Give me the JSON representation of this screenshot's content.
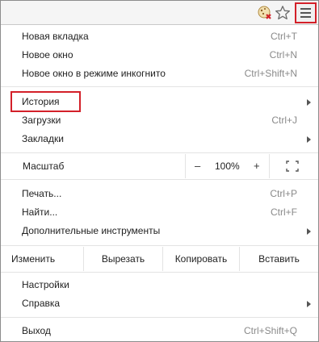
{
  "toolbar": {
    "extension_icon": "cookie-blocked-icon",
    "bookmark_icon": "star-icon",
    "menu_icon": "hamburger-menu-icon"
  },
  "menu": {
    "new_tab": {
      "label": "Новая вкладка",
      "shortcut": "Ctrl+T"
    },
    "new_window": {
      "label": "Новое окно",
      "shortcut": "Ctrl+N"
    },
    "new_incognito": {
      "label": "Новое окно в режиме инкогнито",
      "shortcut": "Ctrl+Shift+N"
    },
    "history": {
      "label": "История"
    },
    "downloads": {
      "label": "Загрузки",
      "shortcut": "Ctrl+J"
    },
    "bookmarks": {
      "label": "Закладки"
    },
    "zoom": {
      "label": "Масштаб",
      "minus": "–",
      "value": "100%",
      "plus": "+"
    },
    "print": {
      "label": "Печать...",
      "shortcut": "Ctrl+P"
    },
    "find": {
      "label": "Найти...",
      "shortcut": "Ctrl+F"
    },
    "more_tools": {
      "label": "Дополнительные инструменты"
    },
    "edit": {
      "label": "Изменить",
      "cut": "Вырезать",
      "copy": "Копировать",
      "paste": "Вставить"
    },
    "settings": {
      "label": "Настройки"
    },
    "help": {
      "label": "Справка"
    },
    "exit": {
      "label": "Выход",
      "shortcut": "Ctrl+Shift+Q"
    }
  },
  "colors": {
    "highlight": "#d32029",
    "shortcut": "#8a8a8a",
    "separator": "#e3e3e3"
  }
}
